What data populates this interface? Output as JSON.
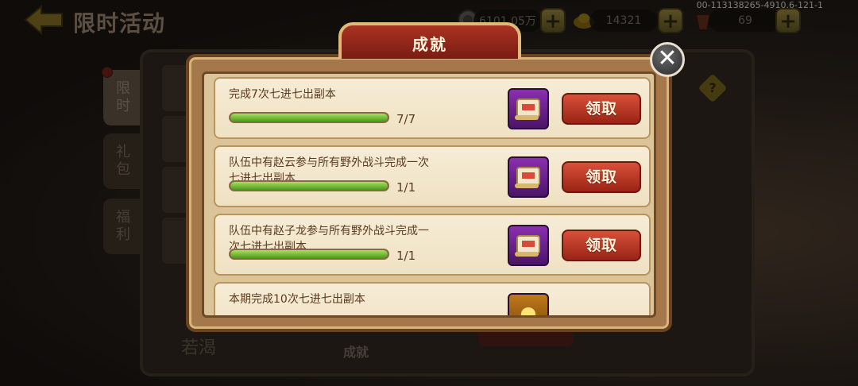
{
  "header": {
    "title": "限时活动",
    "debug_id": "00-113138265-4910.6-121-1",
    "resources": [
      {
        "icon": "silver-coin-icon",
        "value": "6101.05万"
      },
      {
        "icon": "gold-ingot-icon",
        "value": "14321"
      },
      {
        "icon": "stamina-icon",
        "value": "69"
      }
    ],
    "plus_label": "+"
  },
  "side_tabs": [
    "限时",
    "礼包",
    "福利"
  ],
  "background_panel": {
    "bottom_label_left": "若渴",
    "bottom_label_center": "成就"
  },
  "popup": {
    "title": "成就",
    "close_label": "✕",
    "tasks": [
      {
        "title": "完成7次七进七出副本",
        "progress_text": "7/7",
        "progress": 1.0,
        "reward_icon": "title-scroll-icon",
        "claim_label": "领取"
      },
      {
        "title": "队伍中有赵云参与所有野外战斗完成一次七进七出副本",
        "progress_text": "1/1",
        "progress": 1.0,
        "reward_icon": "title-scroll-icon",
        "claim_label": "领取"
      },
      {
        "title": "队伍中有赵子龙参与所有野外战斗完成一次七进七出副本",
        "progress_text": "1/1",
        "progress": 1.0,
        "reward_icon": "title-scroll-icon",
        "claim_label": "领取"
      },
      {
        "title": "本期完成10次七进七出副本",
        "reward_icon": "gold-ingot-icon"
      }
    ]
  },
  "colors": {
    "accent_red": "#a93322",
    "progress_green": "#4c9a1c",
    "panel_beige": "#dcc49a"
  }
}
